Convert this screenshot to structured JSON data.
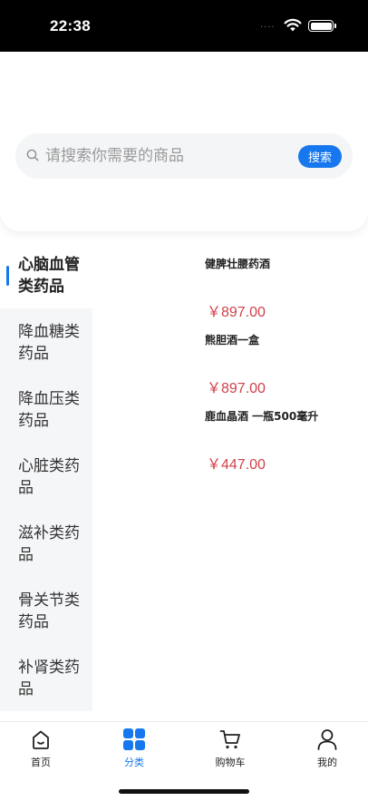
{
  "status_bar": {
    "time": "22:38",
    "dots": "....",
    "wifi_icon": "wifi-icon",
    "battery_icon": "battery-icon"
  },
  "search": {
    "placeholder": "请搜索你需要的商品",
    "value": "",
    "button_label": "搜索"
  },
  "categories": [
    {
      "label": "心脑血管类药品",
      "active": true
    },
    {
      "label": "降血糖类药品",
      "active": false
    },
    {
      "label": "降血压类药品",
      "active": false
    },
    {
      "label": "心脏类药品",
      "active": false
    },
    {
      "label": "滋补类药品",
      "active": false
    },
    {
      "label": "骨关节类药品",
      "active": false
    },
    {
      "label": "补肾类药品",
      "active": false
    }
  ],
  "products": [
    {
      "name": "健脾壮腰药酒",
      "price": "￥897.00"
    },
    {
      "name": "熊胆酒一盒",
      "price": "￥897.00"
    },
    {
      "name": "鹿血晶酒 一瓶500毫升",
      "price": "￥447.00"
    }
  ],
  "tabs": [
    {
      "label": "首页",
      "icon": "home-icon",
      "active": false
    },
    {
      "label": "分类",
      "icon": "grid-icon",
      "active": true
    },
    {
      "label": "购物车",
      "icon": "cart-icon",
      "active": false
    },
    {
      "label": "我的",
      "icon": "user-icon",
      "active": false
    }
  ],
  "colors": {
    "accent": "#1677ee",
    "price": "#d0414b",
    "sidebar_bg": "#f5f6f8"
  }
}
